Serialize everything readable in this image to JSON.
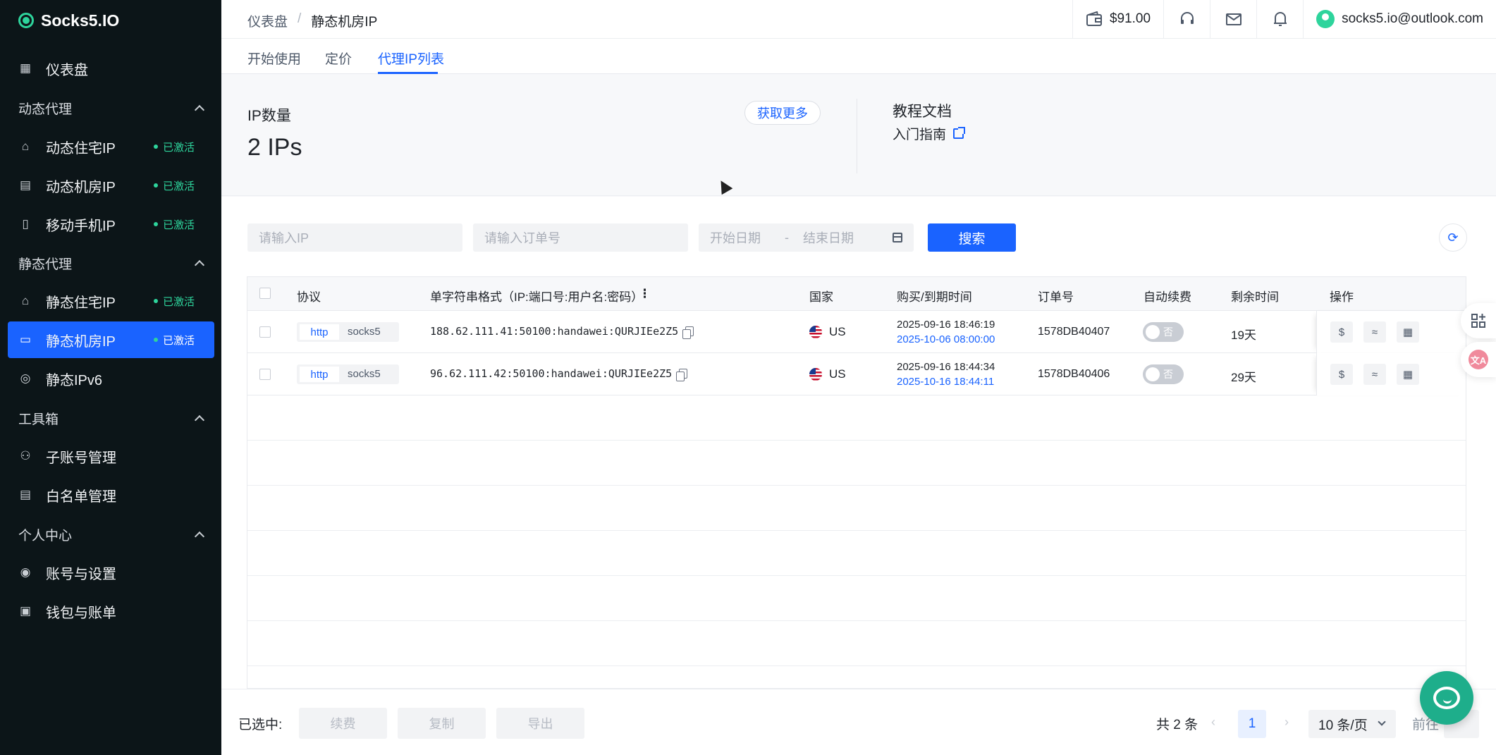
{
  "app": {
    "logo_text": "Socks5.IO",
    "accent": "#1a63ff",
    "brand_green": "#2ed49c"
  },
  "sidebar": {
    "dashboard": {
      "label": "仪表盘",
      "icon": "grid-icon"
    },
    "groups": [
      {
        "label": "动态代理",
        "items": [
          {
            "label": "动态住宅IP",
            "badge": "已激活",
            "icon": "home-cloud-icon"
          },
          {
            "label": "动态机房IP",
            "badge": "已激活",
            "icon": "server-icon"
          },
          {
            "label": "移动手机IP",
            "badge": "已激活",
            "icon": "mobile-icon"
          }
        ]
      },
      {
        "label": "静态代理",
        "items": [
          {
            "label": "静态住宅IP",
            "badge": "已激活",
            "icon": "home-icon"
          },
          {
            "label": "静态机房IP",
            "badge": "已激活",
            "icon": "server-rack-icon",
            "active": true
          },
          {
            "label": "静态IPv6",
            "badge": "",
            "icon": "globe-icon"
          }
        ]
      },
      {
        "label": "工具箱",
        "items": [
          {
            "label": "子账号管理",
            "icon": "users-icon"
          },
          {
            "label": "白名单管理",
            "icon": "list-icon"
          }
        ]
      },
      {
        "label": "个人中心",
        "items": [
          {
            "label": "账号与设置",
            "icon": "user-circle-icon"
          },
          {
            "label": "钱包与账单",
            "icon": "wallet-icon"
          }
        ]
      }
    ]
  },
  "header": {
    "breadcrumb": [
      "仪表盘",
      "/",
      "静态机房IP"
    ],
    "balance": "$91.00",
    "email": "socks5.io@outlook.com"
  },
  "tabs": [
    "开始使用",
    "定价",
    "代理IP列表"
  ],
  "stats": {
    "title": "IP数量",
    "value": "2 IPs",
    "more_button": "获取更多",
    "docs_title": "教程文档",
    "docs_link": "入门指南"
  },
  "filters": {
    "ip_placeholder": "请输入IP",
    "order_placeholder": "请输入订单号",
    "start_date": "开始日期",
    "date_sep": "-",
    "end_date": "结束日期",
    "search_button": "搜索"
  },
  "table": {
    "columns": [
      "协议",
      "单字符串格式（IP:端口号:用户名:密码）",
      "国家",
      "购买/到期时间",
      "订单号",
      "自动续费",
      "剩余时间",
      "操作"
    ],
    "column_menu": "⋮",
    "rows": [
      {
        "proto_a": "http",
        "proto_b": "socks5",
        "credential": "188.62.111.41:50100:handawei:QURJIEe2Z5",
        "country": "US",
        "purchased": "2025-09-16 18:46:19",
        "expires": "2025-10-06 08:00:00",
        "order": "1578DB40407",
        "auto_renew": "否",
        "remaining": "19天"
      },
      {
        "proto_a": "http",
        "proto_b": "socks5",
        "credential": "96.62.111.42:50100:handawei:QURJIEe2Z5",
        "country": "US",
        "purchased": "2025-09-16 18:44:34",
        "expires": "2025-10-16 18:44:11",
        "order": "1578DB40406",
        "auto_renew": "否",
        "remaining": "29天"
      }
    ]
  },
  "bottom": {
    "selected_label": "已选中:",
    "renew": "续费",
    "copy": "复制",
    "export": "导出",
    "total": "共 2 条",
    "page": "1",
    "page_size": "10 条/页",
    "goto": "前往"
  }
}
